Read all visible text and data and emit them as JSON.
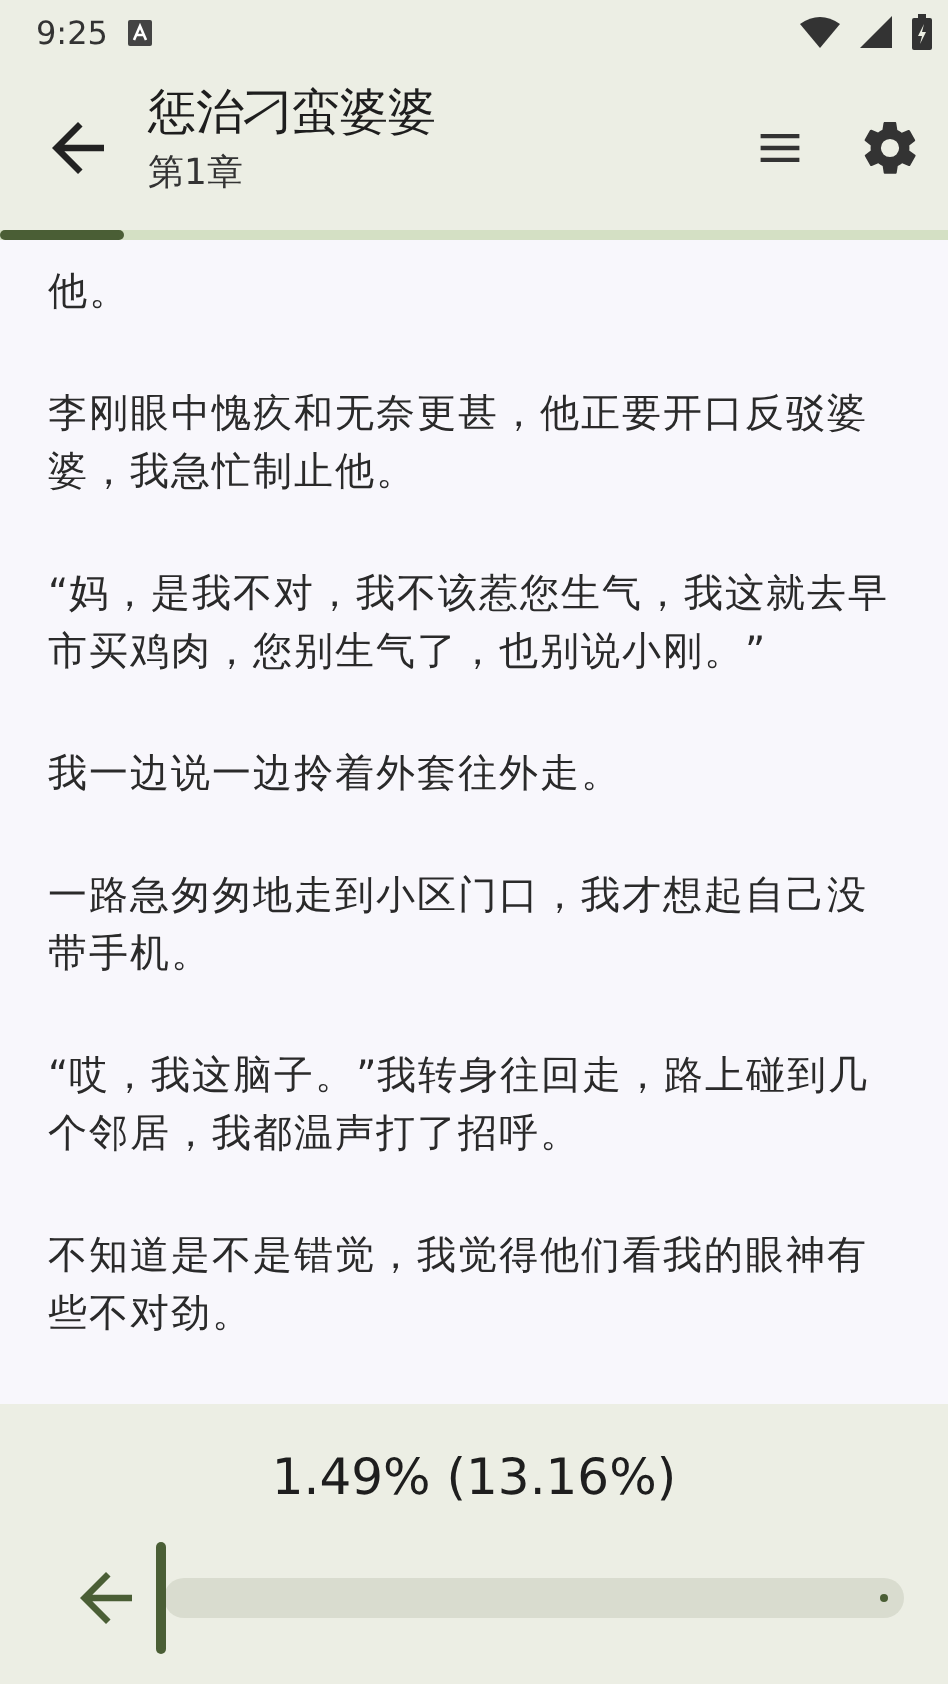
{
  "status_bar": {
    "time": "9:25"
  },
  "toolbar": {
    "title": "惩治刁蛮婆婆",
    "subtitle": "第1章"
  },
  "chapter_progress": {
    "level": 0.1316
  },
  "paragraphs": [
    "他。",
    "李刚眼中愧疚和无奈更甚，他正要开口反驳婆婆，我急忙制止他。",
    "“妈，是我不对，我不该惹您生气，我这就去早市买鸡肉，您别生气了，也别说小刚。”",
    "我一边说一边拎着外套往外走。",
    "一路急匆匆地走到小区门口，我才想起自己没带手机。",
    "“哎，我这脑子。”我转身往回走，路上碰到几个邻居，我都温声打了招呼。",
    "不知道是不是错觉，我觉得他们看我的眼神有些不对劲。"
  ],
  "bottom_bar": {
    "progress_text": "1.49% (13.16%)",
    "slider": {
      "level": 0.0149
    }
  }
}
